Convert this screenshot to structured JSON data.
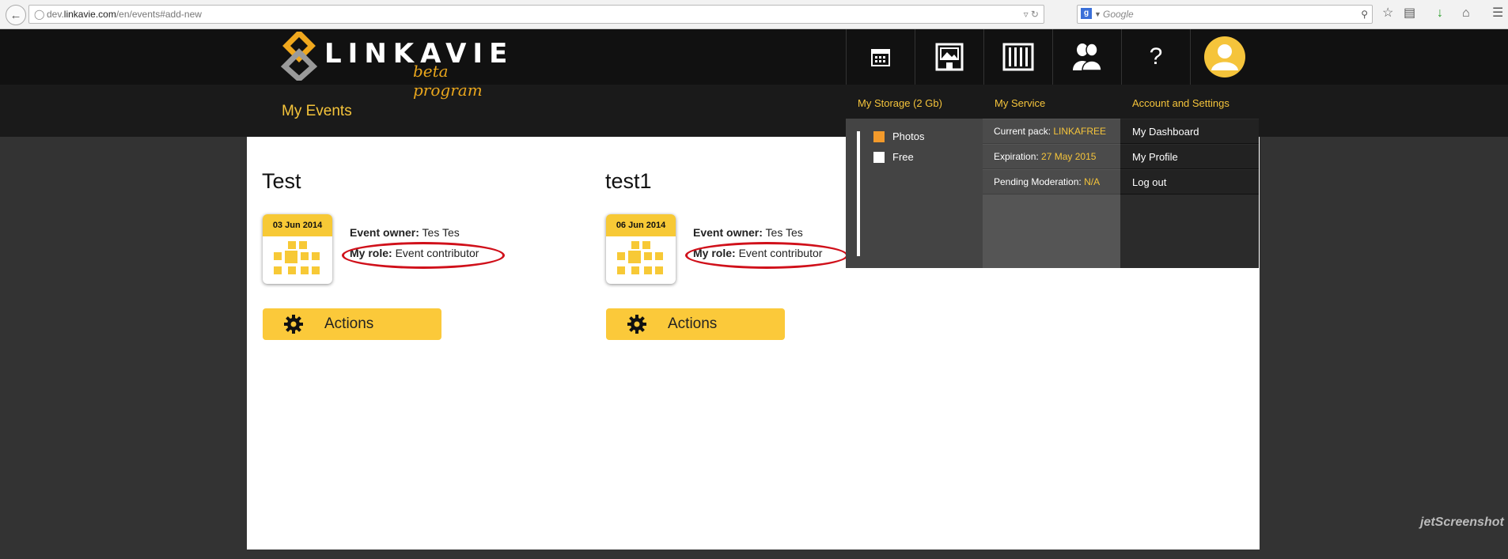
{
  "browser": {
    "url_prefix": "dev.",
    "url_domain": "linkavie.com",
    "url_path": "/en/events#add-new",
    "search_placeholder": "Google",
    "search_engine_letter": "g"
  },
  "logo": {
    "word": "LINKAVIE",
    "subtitle": "beta program"
  },
  "page_title": "My Events",
  "nav": {
    "help_glyph": "?",
    "icons": [
      "calendar-icon",
      "photo-frame-icon",
      "grid-icon",
      "users-icon",
      "help-icon",
      "avatar-icon"
    ]
  },
  "events": [
    {
      "title": "Test",
      "date": "03 Jun 2014",
      "owner_label": "Event owner:",
      "owner_value": "Tes Tes",
      "role_label": "My role:",
      "role_value": "Event contributor",
      "actions_label": "Actions"
    },
    {
      "title": "test1",
      "date": "06 Jun 2014",
      "owner_label": "Event owner:",
      "owner_value": "Tes Tes",
      "role_label": "My role:",
      "role_value": "Event contributor",
      "actions_label": "Actions"
    }
  ],
  "dropdown": {
    "storage": {
      "heading": "My Storage (2 Gb)",
      "legend": [
        {
          "label": "Photos",
          "color": "#f39a2b"
        },
        {
          "label": "Free",
          "color": "#ffffff"
        }
      ]
    },
    "service": {
      "heading": "My Service",
      "rows": [
        {
          "label": "Current pack:",
          "value": "LINKAFREE"
        },
        {
          "label": "Expiration:",
          "value": "27 May 2015"
        },
        {
          "label": "Pending Moderation:",
          "value": "N/A"
        }
      ]
    },
    "account": {
      "heading": "Account and Settings",
      "items": [
        "My Dashboard",
        "My Profile",
        "Log out"
      ]
    }
  },
  "watermark": "jetScreenshot",
  "colors": {
    "accent": "#f5c43b",
    "button": "#fbc93a",
    "highlight_oval": "#d0101a",
    "header": "#111111"
  }
}
